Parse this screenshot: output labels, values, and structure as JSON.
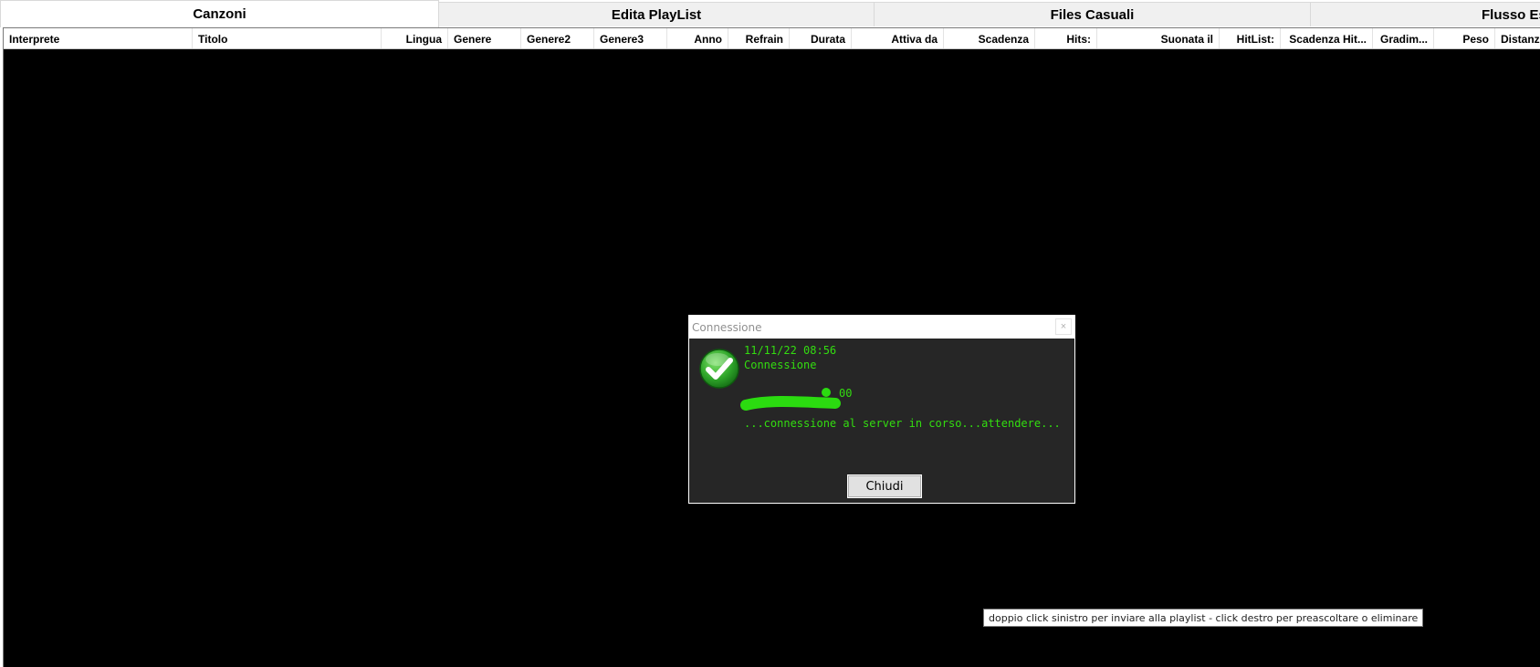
{
  "tabs": [
    {
      "label": "Canzoni",
      "active": true
    },
    {
      "label": "Edita PlayList",
      "active": false
    },
    {
      "label": "Files Casuali",
      "active": false
    },
    {
      "label": "Flusso Es",
      "active": false
    }
  ],
  "columns": [
    {
      "label": "Interprete"
    },
    {
      "label": "Titolo"
    },
    {
      "label": "Lingua"
    },
    {
      "label": "Genere"
    },
    {
      "label": "Genere2"
    },
    {
      "label": "Genere3"
    },
    {
      "label": "Anno"
    },
    {
      "label": "Refrain"
    },
    {
      "label": "Durata"
    },
    {
      "label": "Attiva da"
    },
    {
      "label": "Scadenza"
    },
    {
      "label": "Hits:"
    },
    {
      "label": "Suonata il"
    },
    {
      "label": "HitList:"
    },
    {
      "label": "Scadenza Hit..."
    },
    {
      "label": "Gradim..."
    },
    {
      "label": "Peso"
    },
    {
      "label": "Distanz"
    }
  ],
  "dialog": {
    "title": "Connessione",
    "close_glyph": "×",
    "timestamp": "11/11/22 08:56",
    "heading": "Connessione",
    "redacted_suffix": "00",
    "status": "...connessione al server in corso...attendere...",
    "button_label": "Chiudi",
    "text_color": "#33dd10"
  },
  "tooltip": {
    "text": "doppio click sinistro per inviare alla playlist - click destro per preascoltare o eliminare"
  },
  "icons": {
    "success": "check-circle-icon"
  }
}
